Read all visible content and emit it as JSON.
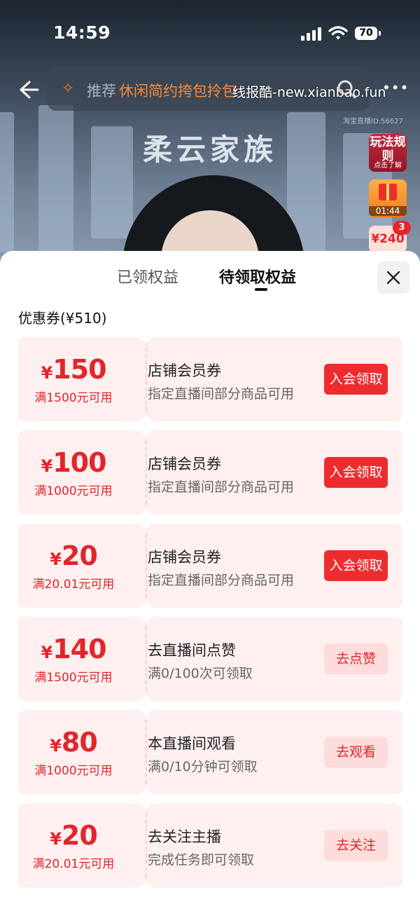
{
  "status_bar": {
    "time": "14:59",
    "battery": "70"
  },
  "top_bar": {
    "search_prefix": "推荐",
    "search_term": "休闲简约挎包拎包",
    "watermark": "线报酷-new.xianbao.fun",
    "more": "•••",
    "room_id": "淘宝直播ID:56627"
  },
  "live": {
    "title": "柔云家族",
    "side": {
      "rules_title": "玩法规则",
      "rules_sub": "点击了解",
      "gift_timer": "01:44",
      "coupon_amount": "¥240",
      "coupon_badge": "3"
    }
  },
  "sheet": {
    "tabs": [
      {
        "label": "已领权益",
        "active": false
      },
      {
        "label": "待领取权益",
        "active": true
      }
    ],
    "section_title": "优惠券(¥510)",
    "coupons": [
      {
        "currency": "¥",
        "amount": "150",
        "condition": "满1500元可用",
        "title": "店铺会员券",
        "subtitle": "指定直播间部分商品可用",
        "action": "入会领取",
        "style": "primary"
      },
      {
        "currency": "¥",
        "amount": "100",
        "condition": "满1000元可用",
        "title": "店铺会员券",
        "subtitle": "指定直播间部分商品可用",
        "action": "入会领取",
        "style": "primary"
      },
      {
        "currency": "¥",
        "amount": "20",
        "condition": "满20.01元可用",
        "title": "店铺会员券",
        "subtitle": "指定直播间部分商品可用",
        "action": "入会领取",
        "style": "primary"
      },
      {
        "currency": "¥",
        "amount": "140",
        "condition": "满1500元可用",
        "title": "去直播间点赞",
        "subtitle": "满0/100次可领取",
        "action": "去点赞",
        "style": "task"
      },
      {
        "currency": "¥",
        "amount": "80",
        "condition": "满1000元可用",
        "title": "本直播间观看",
        "subtitle": "满0/10分钟可领取",
        "action": "去观看",
        "style": "task"
      },
      {
        "currency": "¥",
        "amount": "20",
        "condition": "满20.01元可用",
        "title": "去关注主播",
        "subtitle": "完成任务即可领取",
        "action": "去关注",
        "style": "task"
      }
    ]
  },
  "colors": {
    "accent": "#ee2c2f",
    "coupon_bg": "#fff0f0",
    "task_btn_bg": "#ffdcdc"
  }
}
